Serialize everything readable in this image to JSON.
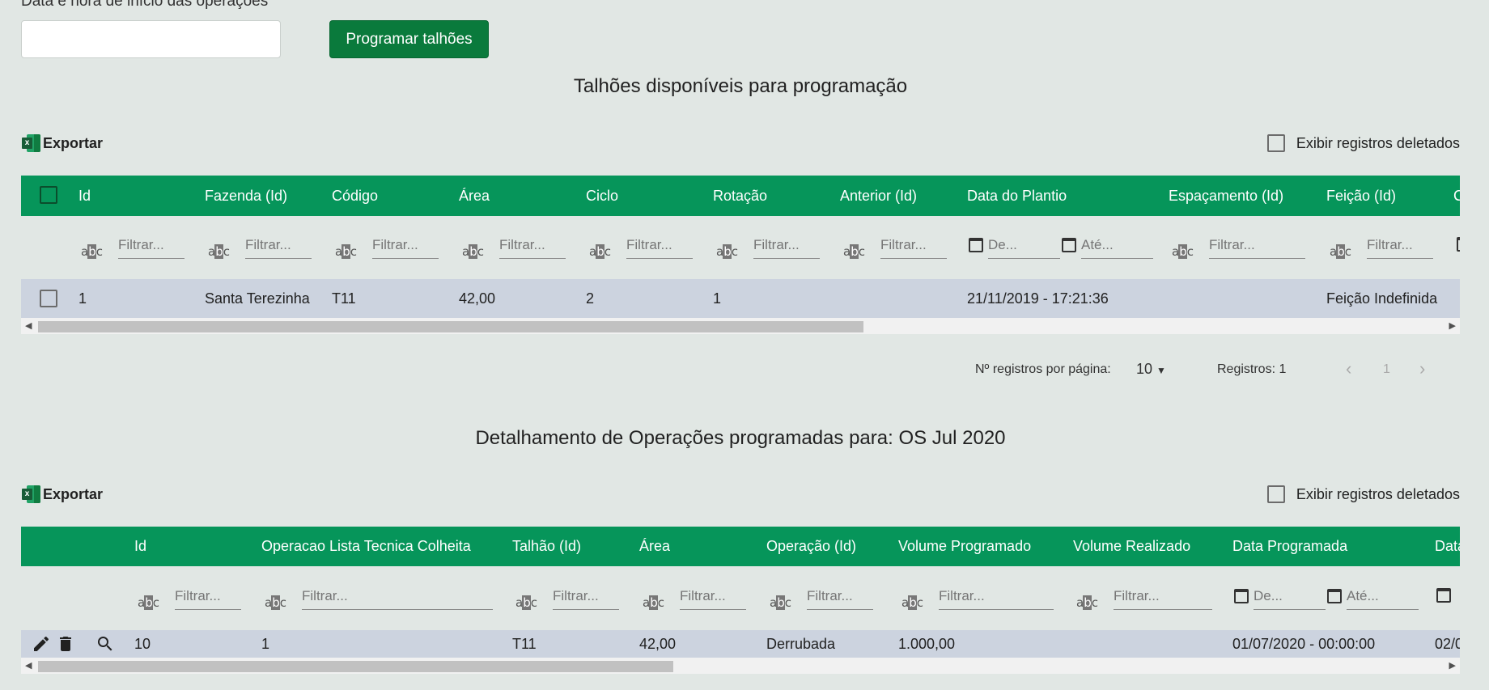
{
  "form": {
    "label": "Data e hora de início das operações",
    "date_value": "",
    "program_button": "Programar talhões"
  },
  "available": {
    "title": "Talhões disponíveis para programação",
    "export_label": "Exportar",
    "show_deleted_label": "Exibir registros deletados",
    "columns": [
      "Id",
      "Fazenda (Id)",
      "Código",
      "Área",
      "Ciclo",
      "Rotação",
      "Anterior (Id)",
      "Data do Plantio",
      "Espaçamento (Id)",
      "Feição (Id)",
      "C"
    ],
    "filter_placeholder": "Filtrar...",
    "date_from_placeholder": "De...",
    "date_to_placeholder": "Até...",
    "rows": [
      {
        "id": "1",
        "fazenda": "Santa Terezinha",
        "codigo": "T11",
        "area": "42,00",
        "ciclo": "2",
        "rotacao": "1",
        "anterior": "",
        "data_plantio": "21/11/2019 - 17:21:36",
        "espacamento": "",
        "feicao": "Feição Indefinida"
      }
    ],
    "pager": {
      "per_page_label": "Nº registros por página:",
      "per_page_value": "10",
      "records_label": "Registros: 1",
      "page": "1"
    }
  },
  "scheduled": {
    "title": "Detalhamento de Operações programadas para: OS Jul 2020",
    "export_label": "Exportar",
    "show_deleted_label": "Exibir registros deletados",
    "columns": [
      "Id",
      "Operacao Lista Tecnica Colheita",
      "Talhão (Id)",
      "Área",
      "Operação (Id)",
      "Volume Programado",
      "Volume Realizado",
      "Data Programada",
      "Data"
    ],
    "filter_placeholder": "Filtrar...",
    "date_from_placeholder": "De...",
    "date_to_placeholder": "Até...",
    "rows": [
      {
        "id": "10",
        "operacao_lista": "1",
        "talhao": "T11",
        "area": "42,00",
        "operacao": "Derrubada",
        "vol_programado": "1.000,00",
        "vol_realizado": "",
        "data_programada": "01/07/2020 - 00:00:00",
        "data": "02/0"
      }
    ]
  },
  "icons": {
    "excel": "excel-icon",
    "text_filter": "text-filter-icon",
    "calendar": "calendar-icon",
    "edit": "pencil-icon",
    "delete": "trash-icon",
    "view": "search-icon"
  },
  "colors": {
    "header_green": "#06955a",
    "button_green": "#0a7a3c",
    "row_bg": "#ccd3df",
    "page_bg": "#e1e7e4"
  }
}
